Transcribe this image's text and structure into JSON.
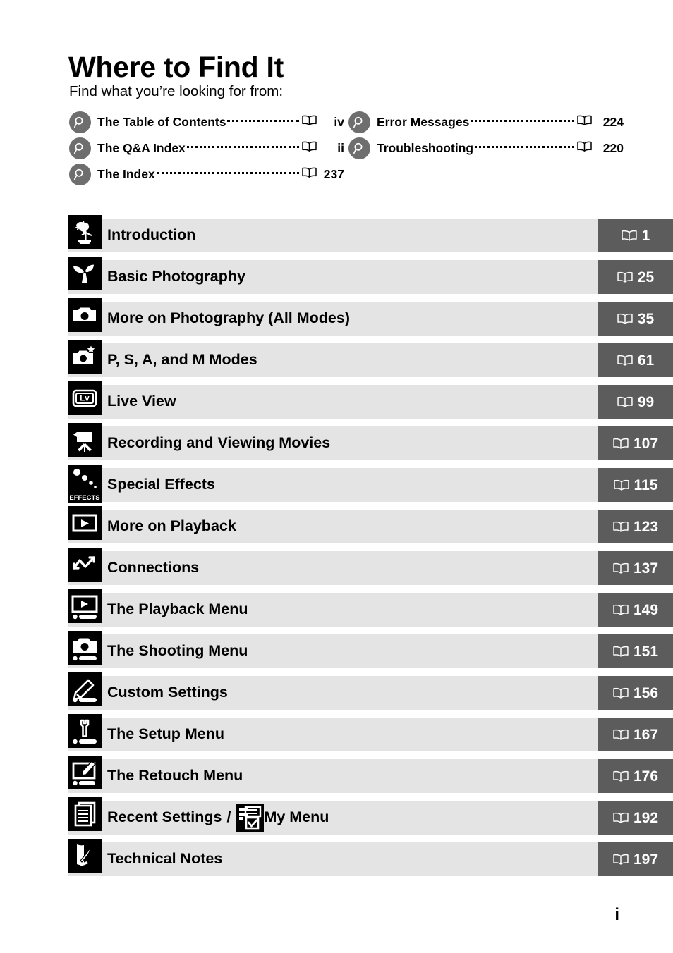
{
  "header": {
    "title": "Where to Find It",
    "subtitle": "Find what you’re looking for from:"
  },
  "find_links": {
    "left_column": [
      {
        "icon": "search-icon",
        "label": "The Table of Contents",
        "book_icon": "book-icon",
        "page": "iv"
      },
      {
        "icon": "search-icon",
        "label": "The Q&A Index",
        "book_icon": "book-icon",
        "page": "ii"
      },
      {
        "icon": "search-icon",
        "label": "The Index",
        "book_icon": "book-icon",
        "page": "237"
      }
    ],
    "right_column": [
      {
        "icon": "search-icon",
        "label": "Error Messages",
        "book_icon": "book-icon",
        "page": "224"
      },
      {
        "icon": "search-icon",
        "label": "Troubleshooting",
        "book_icon": "book-icon",
        "page": "220"
      }
    ]
  },
  "chapters": [
    {
      "icon": "weathervane-rooster-icon",
      "title": "Introduction",
      "page": "1"
    },
    {
      "icon": "sprouting-plant-icon",
      "title": "Basic Photography",
      "page": "25"
    },
    {
      "icon": "camera-icon",
      "title": "More on Photography (All Modes)",
      "page": "35"
    },
    {
      "icon": "camera-star-icon",
      "title": "P, S, A, and M Modes",
      "page": "61"
    },
    {
      "icon": "live-view-icon",
      "title": "Live View",
      "page": "99"
    },
    {
      "icon": "movie-camera-icon",
      "title": "Recording and Viewing Movies",
      "page": "107"
    },
    {
      "icon": "special-effects-icon",
      "title": "Special Effects",
      "page": "115",
      "icon_caption": "EFFECTS"
    },
    {
      "icon": "playback-icon",
      "title": "More on Playback",
      "page": "123"
    },
    {
      "icon": "connections-icon",
      "title": "Connections",
      "page": "137"
    },
    {
      "icon": "playback-menu-icon",
      "title": "The Playback Menu",
      "page": "149"
    },
    {
      "icon": "shooting-menu-icon",
      "title": "The Shooting Menu",
      "page": "151"
    },
    {
      "icon": "pencil-icon",
      "title": "Custom Settings",
      "page": "156"
    },
    {
      "icon": "wrench-icon",
      "title": "The Setup Menu",
      "page": "167"
    },
    {
      "icon": "retouch-brush-icon",
      "title": "The Retouch Menu",
      "page": "176"
    },
    {
      "icon": "recent-settings-icon",
      "title": "Recent Settings",
      "separator": "/",
      "title2": "My Menu",
      "icon2": "my-menu-checklist-icon",
      "page": "192"
    },
    {
      "icon": "quill-notes-icon",
      "title": "Technical Notes",
      "page": "197"
    }
  ],
  "footer": {
    "folio": "i"
  },
  "colors": {
    "row_background": "#e4e4e4",
    "page_box": "#5c5c5c",
    "icon_background": "#000000",
    "search_circle": "#6e6e6e",
    "text": "#000000",
    "page_text": "#ffffff"
  }
}
